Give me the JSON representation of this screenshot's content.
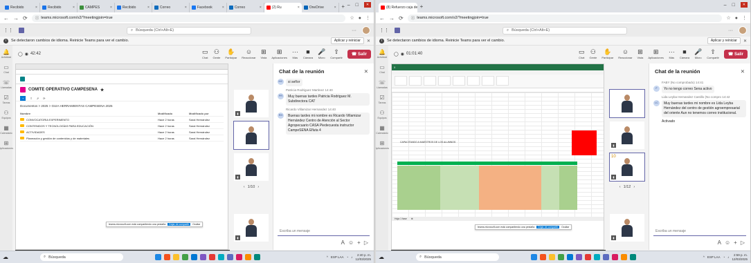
{
  "left": {
    "browser": {
      "tabs": [
        "Recibido",
        "Recibido",
        "CAMPES",
        "Recibido",
        "Correo",
        "Facebook",
        "Correo",
        "(2) Ru",
        "OneDrive"
      ],
      "url": "teams.microsoft.com/v2/?meetingjoin=true"
    },
    "teams": {
      "search_placeholder": "Búsqueda (Ctrl+Alt+E)",
      "banner_text": "Se detectaron cambios de idioma. Reinicie Teams para ver el cambio.",
      "apply_label": "Aplicar y reiniciar",
      "rail": [
        "Actividad",
        "Chat",
        "Llamadas",
        "Tareas",
        "Equipos",
        "Calendario",
        "Aplicaciones"
      ],
      "timer": "42:42",
      "tools": [
        "Chat",
        "Gente",
        "Participar",
        "Reaccionar",
        "Vista",
        "Aplicaciones",
        "Más",
        "Cámara",
        "Micro",
        "Compartir"
      ],
      "leave_label": "Salir",
      "pager": "1/10"
    },
    "shared": {
      "site_title": "COMITE OPERATIVO CAMPESENA",
      "breadcrumb": "Documentos > 2025 > GUIA HERRAMIENTAS CAMPESENA 2025",
      "columns": [
        "Nombre",
        "Modificado",
        "Modificado por"
      ],
      "rows": [
        {
          "name": "CONVOCATORIA EXPERIMENTO",
          "date": "Hace 2 horas",
          "by": "Sarai Hernández"
        },
        {
          "name": "CONTENIDOS Y TECNOLOGÍAS PARA EDUCACIÓN",
          "date": "Hace 2 horas",
          "by": "Sarai Hernández"
        },
        {
          "name": "ACTIVIDADES",
          "date": "Hace 2 horas",
          "by": "Sarai Hernández"
        },
        {
          "name": "Planeación y gestión de contenidos y de materiales",
          "date": "Hace 2 horas",
          "by": "Sarai Hernández"
        }
      ],
      "popup_text": "teams.microsoft.com está compartiendo una pestaña",
      "popup_stop": "Dejar de compartir",
      "popup_hide": "Ocultar"
    },
    "presenter": "Adrian Alirio Torres Beltran",
    "chat": {
      "title": "Chat de la reunión",
      "items": [
        {
          "kind": "msg",
          "avatar": "MC",
          "text": "si señor"
        },
        {
          "kind": "meta",
          "text": "Patricia Rodriguez Martinez 14:40"
        },
        {
          "kind": "msg",
          "avatar": "PR",
          "text": "Muy buenas tardes Patricia Rodriguez M. Subdirectora CAT"
        },
        {
          "kind": "meta",
          "text": "Ricardo Villamizar Hernandez 14:40"
        },
        {
          "kind": "msg",
          "avatar": "RH",
          "text": "Buenas tardes mi nombre es Ricardo Villamizar Hernández Centro de Atención al Sector Agropecuario CASA Piedecuesta instructor CampeSENA Efluta 4"
        }
      ],
      "compose_placeholder": "Escriba un mensaje"
    },
    "taskbar": {
      "search": "Búsqueda",
      "lang": "ESP LAA",
      "time": "2:40 p. m.",
      "date": "12/03/2025"
    }
  },
  "right": {
    "browser": {
      "tabs": [
        "(8) Refuerzo caja de herran"
      ],
      "url": "teams.microsoft.com/v2/?meetingjoin=true"
    },
    "teams": {
      "search_placeholder": "Búsqueda (Ctrl+Alt+E)",
      "banner_text": "Se detectaron cambios de idioma. Reinicie Teams para ver el cambio.",
      "apply_label": "Aplicar y reiniciar",
      "rail": [
        "Actividad",
        "Chat",
        "Llamadas",
        "Tareas",
        "Equipos",
        "Calendario",
        "Aplicaciones"
      ],
      "timer": "01:01:40",
      "tools": [
        "Chat",
        "Gente",
        "Participar",
        "Reaccionar",
        "Vista",
        "Aplicaciones",
        "Más",
        "Cámara",
        "Micro",
        "Compartir"
      ],
      "leave_label": "Salir",
      "pager": "1/12",
      "tile_number": "10"
    },
    "shared": {
      "row_label": "CAPACITANDO A MAESTROS DE LOS ALUMNOS",
      "sheet_tab": "Hoja 1 fase",
      "popup_text": "teams.microsoft.com está compartiendo una pestaña",
      "popup_stop": "Dejar de compartir",
      "popup_hide": "Ocultar"
    },
    "presenter": "Adrian Alirio Torres Beltran",
    "chat": {
      "title": "Chat de la reunión",
      "items": [
        {
          "kind": "meta",
          "text": "FABY (No comprobado) 14:41"
        },
        {
          "kind": "msg",
          "avatar": "F",
          "text": "Yo no tengo correo Sena activo"
        },
        {
          "kind": "meta",
          "text": "Lida Leyba Hernandez Castillo (No compro 14:42"
        },
        {
          "kind": "msg",
          "avatar": "LC",
          "text": "Muy buenas tardes mi nombre es Lida Leyba Hernández del centro de gestión agroempresarial del oriente Aun no tenemos correo institucional."
        },
        {
          "kind": "plain",
          "text": "Activado"
        }
      ],
      "compose_placeholder": "Escriba un mensaje"
    },
    "taskbar": {
      "search": "Búsqueda",
      "lang": "ESP LAA",
      "time": "2:59 p. m.",
      "date": "12/03/2025"
    }
  },
  "colors": {
    "teams_purple": "#6264a7",
    "leave_red": "#c4314b",
    "excel_green": "#217346",
    "alert_red": "#ff0000"
  }
}
